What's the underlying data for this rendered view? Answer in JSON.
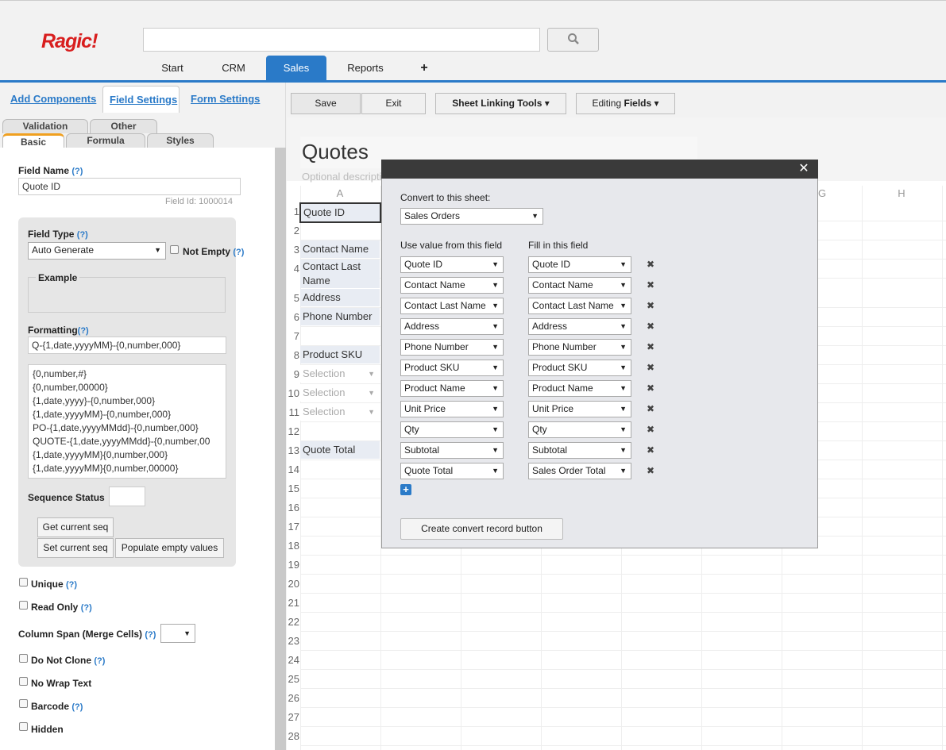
{
  "app": {
    "logo": "Ragic!"
  },
  "nav_tabs": [
    "Start",
    "CRM",
    "Sales",
    "Reports",
    "+"
  ],
  "active_tab": "Sales",
  "left_panel": {
    "top_tabs": [
      "Add Components",
      "Field Settings",
      "Form Settings"
    ],
    "sub_tabs_row1": [
      "Validation",
      "Other"
    ],
    "sub_tabs_row2": [
      "Basic",
      "Formula",
      "Styles"
    ],
    "field_name_label": "Field Name",
    "field_name_value": "Quote ID",
    "field_id": "Field Id: 1000014",
    "field_type_label": "Field Type",
    "field_type_value": "Auto Generate",
    "not_empty_label": "Not Empty",
    "example_label": "Example",
    "formatting_label": "Formatting",
    "formatting_value": "Q-{1,date,yyyyMM}-{0,number,000}",
    "format_options": [
      "{0,number,#}",
      "{0,number,00000}",
      "{1,date,yyyy}-{0,number,000}",
      "{1,date,yyyyMM}-{0,number,000}",
      "PO-{1,date,yyyyMMdd}-{0,number,000}",
      "QUOTE-{1,date,yyyyMMdd}-{0,number,00",
      "{1,date,yyyyMM}{0,number,000}",
      "{1,date,yyyyMM}{0,number,00000}"
    ],
    "sequence_status_label": "Sequence Status",
    "get_seq_btn": "Get current seq",
    "set_seq_btn": "Set current seq",
    "populate_btn": "Populate empty values",
    "help": "(?)",
    "checkboxes": {
      "unique": "Unique",
      "read_only": "Read Only",
      "column_span": "Column Span (Merge Cells)",
      "do_not_clone": "Do Not Clone",
      "no_wrap": "No Wrap Text",
      "barcode": "Barcode",
      "hidden": "Hidden"
    }
  },
  "toolbar": {
    "save": "Save",
    "exit": "Exit",
    "sheet_linking": "Sheet Linking Tools",
    "editing_fields_prefix": "Editing ",
    "editing_fields_bold": "Fields"
  },
  "sheet": {
    "title": "Quotes",
    "description": "Optional description of your form",
    "columns": [
      "A",
      "G",
      "H"
    ],
    "rows": [
      "1",
      "2",
      "3",
      "4",
      "5",
      "6",
      "7",
      "8",
      "9",
      "10",
      "11",
      "12",
      "13",
      "14",
      "15",
      "16",
      "17",
      "18",
      "19",
      "20",
      "21",
      "22",
      "23",
      "24",
      "25",
      "26",
      "27",
      "28"
    ],
    "cells": {
      "r1": "Quote ID",
      "r3": "Contact Name",
      "r4a": "Contact Last",
      "r4b": "Name",
      "r5": "Address",
      "r6": "Phone Number",
      "r8": "Product SKU",
      "r9": "Selection",
      "r10": "Selection",
      "r11": "Selection",
      "r13": "Quote Total"
    }
  },
  "dialog": {
    "convert_label": "Convert to this sheet:",
    "convert_value": "Sales Orders",
    "col_from": "Use value from this field",
    "col_to": "Fill in this field",
    "mappings": [
      {
        "from": "Quote ID",
        "to": "Quote ID"
      },
      {
        "from": "Contact Name",
        "to": "Contact Name"
      },
      {
        "from": "Contact Last Name",
        "to": "Contact Last Name"
      },
      {
        "from": "Address",
        "to": "Address"
      },
      {
        "from": "Phone Number",
        "to": "Phone Number"
      },
      {
        "from": "Product SKU",
        "to": "Product SKU"
      },
      {
        "from": "Product Name",
        "to": "Product Name"
      },
      {
        "from": "Unit Price",
        "to": "Unit Price"
      },
      {
        "from": "Qty",
        "to": "Qty"
      },
      {
        "from": "Subtotal",
        "to": "Subtotal"
      },
      {
        "from": "Quote Total",
        "to": "Sales Order Total"
      }
    ],
    "create_button": "Create convert record button",
    "close": "✕",
    "remove": "✖",
    "add": "+"
  }
}
